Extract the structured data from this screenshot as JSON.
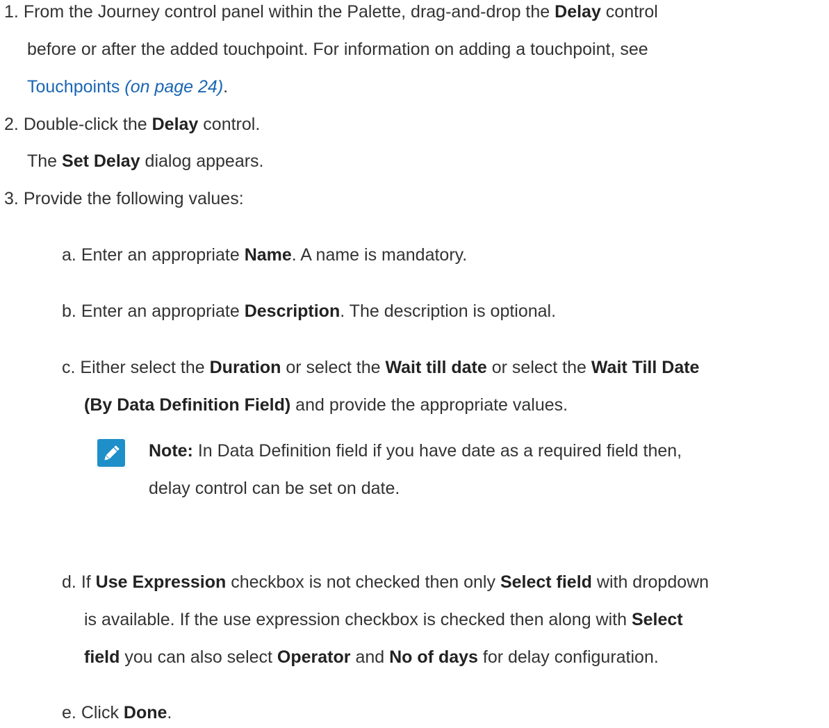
{
  "steps": [
    {
      "num": "1.",
      "lines": [
        {
          "t1": "From the Journey control panel within the Palette, drag-and-drop the ",
          "b1": "Delay",
          "t2": " control"
        },
        {
          "t1": "before or after the added touchpoint. For information on adding a touchpoint, see"
        },
        {
          "link_text": "Touchpoints",
          "link_page": "(on page 24)",
          "t_after": "."
        }
      ]
    },
    {
      "num": "2.",
      "lines": [
        {
          "t1": "Double-click the ",
          "b1": "Delay",
          "t2": " control."
        },
        {
          "t1": "The ",
          "b1": "Set Delay",
          "t2": " dialog appears."
        }
      ]
    },
    {
      "num": "3.",
      "lines": [
        {
          "t1": "Provide the following values:"
        }
      ]
    }
  ],
  "substeps": {
    "a": {
      "label": "a.",
      "t1": "Enter an appropriate ",
      "b1": "Name",
      "t2": ". A name is mandatory."
    },
    "b": {
      "label": "b.",
      "t1": "Enter an appropriate ",
      "b1": "Description",
      "t2": ". The description is optional."
    },
    "c": {
      "label": "c.",
      "l1": {
        "t1": "Either select the ",
        "b1": "Duration",
        "t2": " or select the ",
        "b2": "Wait till date",
        "t3": " or select the ",
        "b3": "Wait Till Date"
      },
      "l2": {
        "b1": "(By Data Definition Field)",
        "t1": " and provide the appropriate values."
      }
    },
    "note": {
      "label": "Note:",
      "l1": " In Data Definition field if you have date as a required field then,",
      "l2": "delay control can be set on date."
    },
    "d": {
      "label": "d.",
      "l1": {
        "t1": "If ",
        "b1": "Use Expression",
        "t2": " checkbox is not checked then only ",
        "b2": "Select field",
        "t3": " with dropdown"
      },
      "l2": {
        "t1": "is available. If the use expression checkbox is checked then along with ",
        "b1": "Select"
      },
      "l3": {
        "b1": "field",
        "t1": " you can also select ",
        "b2": "Operator",
        "t2": " and ",
        "b3": "No of days",
        "t3": " for delay configuration."
      }
    },
    "e": {
      "label": "e.",
      "t1": "Click ",
      "b1": "Done",
      "t2": "."
    }
  },
  "colors": {
    "text": "#333333",
    "bold": "#222222",
    "link": "#1a66b3",
    "note_icon_bg": "#1f8fc9"
  },
  "icons": {
    "note": "pencil-note-icon"
  }
}
